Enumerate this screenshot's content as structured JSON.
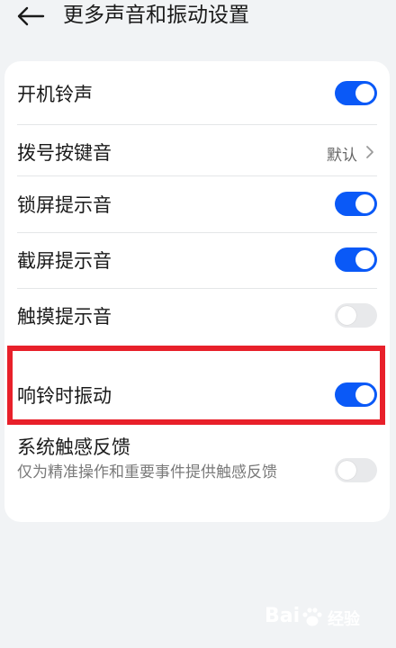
{
  "header": {
    "title": "更多声音和振动设置"
  },
  "settings": [
    {
      "label": "开机铃声",
      "type": "toggle",
      "state": "on"
    },
    {
      "label": "拨号按键音",
      "type": "link",
      "value": "默认"
    },
    {
      "label": "锁屏提示音",
      "type": "toggle",
      "state": "on"
    },
    {
      "label": "截屏提示音",
      "type": "toggle",
      "state": "on"
    },
    {
      "label": "触摸提示音",
      "type": "toggle",
      "state": "off"
    },
    {
      "label": "响铃时振动",
      "type": "toggle",
      "state": "on"
    },
    {
      "label": "系统触感反馈",
      "type": "toggle",
      "state": "off",
      "description": "仅为精准操作和重要事件提供触感反馈"
    }
  ],
  "watermark": {
    "text_a": "Bai",
    "text_b": "经验"
  },
  "colors": {
    "accent": "#0a59f7",
    "highlight": "#e8202a",
    "background": "#f1f3f5"
  }
}
